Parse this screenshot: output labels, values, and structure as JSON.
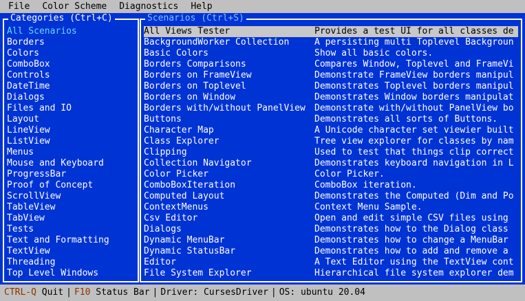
{
  "menubar": {
    "items": [
      "File",
      "Color Scheme",
      "Diagnostics",
      "Help"
    ]
  },
  "categories": {
    "title": "Categories (Ctrl+C)",
    "selected_index": 0,
    "items": [
      "All Scenarios",
      "Borders",
      "Colors",
      "ComboBox",
      "Controls",
      "DateTime",
      "Dialogs",
      "Files and IO",
      "Layout",
      "LineView",
      "ListView",
      "Menus",
      "Mouse and Keyboard",
      "ProgressBar",
      "Proof of Concept",
      "ScrollView",
      "TableView",
      "TabView",
      "Tests",
      "Text and Formatting",
      "TextView",
      "Threading",
      "Top Level Windows"
    ]
  },
  "scenarios": {
    "title": "Scenarios (Ctrl+S)",
    "selected_index": 0,
    "rows": [
      {
        "name": "All Views Tester",
        "desc": "Provides a test UI for all classes de"
      },
      {
        "name": "BackgroundWorker Collection",
        "desc": "A persisting multi Toplevel Backgroun"
      },
      {
        "name": "Basic Colors",
        "desc": "Show all basic colors."
      },
      {
        "name": "Borders Comparisons",
        "desc": "Compares Window, Toplevel and FrameVi"
      },
      {
        "name": "Borders on FrameView",
        "desc": "Demonstrate FrameView borders manipul"
      },
      {
        "name": "Borders on Toplevel",
        "desc": "Demonstrates Toplevel borders manipul"
      },
      {
        "name": "Borders on Window",
        "desc": "Demonstrates Window borders manipulat"
      },
      {
        "name": "Borders with/without PanelView",
        "desc": "Demonstrate with/without PanelView bo"
      },
      {
        "name": "Buttons",
        "desc": "Demonstrates all sorts of Buttons."
      },
      {
        "name": "Character Map",
        "desc": "A Unicode character set viewier built"
      },
      {
        "name": "Class Explorer",
        "desc": "Tree view explorer for classes by nam"
      },
      {
        "name": "Clipping",
        "desc": "Used to test that things clip correct"
      },
      {
        "name": "Collection Navigator",
        "desc": "Demonstrates keyboard navigation in L"
      },
      {
        "name": "Color Picker",
        "desc": "Color Picker."
      },
      {
        "name": "ComboBoxIteration",
        "desc": "ComboBox iteration."
      },
      {
        "name": "Computed Layout",
        "desc": "Demonstrates the Computed (Dim and Po"
      },
      {
        "name": "ContextMenus",
        "desc": "Context Menu Sample."
      },
      {
        "name": "Csv Editor",
        "desc": "Open and edit simple CSV files using"
      },
      {
        "name": "Dialogs",
        "desc": "Demonstrates how to the Dialog class"
      },
      {
        "name": "Dynamic MenuBar",
        "desc": "Demonstrates how to change a MenuBar"
      },
      {
        "name": "Dynamic StatusBar",
        "desc": "Demonstrates how to add and remove a"
      },
      {
        "name": "Editor",
        "desc": "A Text Editor using the TextView cont"
      },
      {
        "name": "File System Explorer",
        "desc": "Hierarchical file system explorer dem"
      }
    ]
  },
  "statusbar": {
    "quit_key": "CTRL-Q",
    "quit_label": "Quit",
    "statusbar_key": "F10",
    "statusbar_label": "Status Bar",
    "driver": "Driver: CursesDriver",
    "os": "OS: ubuntu 20.04",
    "separator": "|"
  },
  "colors": {
    "background": "#0033d4",
    "menubar": "#c0c0c0",
    "selected_row": "#c8c8c8",
    "selected_category": "#66d9ff",
    "status_key": "#8a3300"
  }
}
